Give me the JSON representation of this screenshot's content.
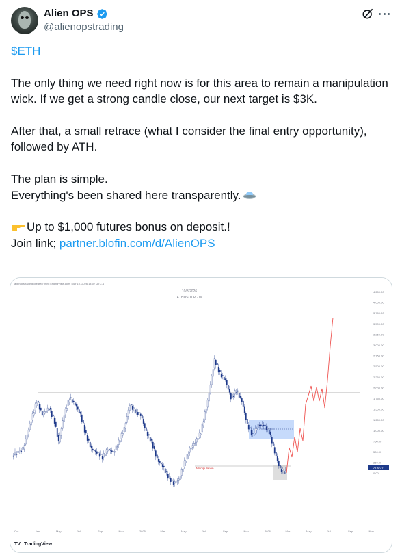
{
  "author": {
    "display_name": "Alien OPS",
    "handle": "@alienopstrading",
    "verified": true,
    "avatar_icon": "alien-avatar"
  },
  "icons": {
    "grok": "grok-icon",
    "more": "more-icon"
  },
  "post": {
    "cashtag": "$ETH",
    "paragraph1": "The only thing we need right now is for this area to remain a manipulation wick. If we get a strong candle close, our next target is $3K.",
    "paragraph2": "After that, a small retrace (what I consider the final entry opportunity), followed by ATH.",
    "line3a": "The plan is simple.",
    "line3b": "Everything's been shared here transparently.",
    "line4": "Up to $1,000 futures bonus on deposit.!",
    "join_label": "Join link; ",
    "join_link": "partner.blofin.com/d/AlienOPS"
  },
  "chart": {
    "header_note": "alienopstrading created with TradingView.com, Mar 10, 2026 14:07 UTC-4",
    "date_label": "10/3/2026",
    "symbol_label": "ETHUSDT.P · W",
    "annotation": "Manipulation",
    "price_tag": "2,066.11",
    "watermark": "TradingView",
    "y_ticks": [
      "4,250.00",
      "4,000.00",
      "3,750.00",
      "3,500.00",
      "3,250.00",
      "3,000.00",
      "2,750.00",
      "2,500.00",
      "2,250.00",
      "2,000.00",
      "1,750.00",
      "1,500.00",
      "1,250.00",
      "1,000.00",
      "750.00",
      "500.00",
      "250.00",
      "0.00"
    ],
    "x_ticks": [
      "Oct",
      "Jan",
      "May",
      "Jul",
      "Sep",
      "Nov",
      "2025",
      "Mar",
      "May",
      "Jul",
      "Sep",
      "Nov",
      "2026",
      "Mar",
      "May",
      "Jul",
      "Sep",
      "Nov"
    ],
    "colors": {
      "up": "#ffffff",
      "down": "#1e3a8a",
      "projection": "#ef5350",
      "level": "#9e9e9e",
      "zone": "#aecbfa"
    }
  }
}
